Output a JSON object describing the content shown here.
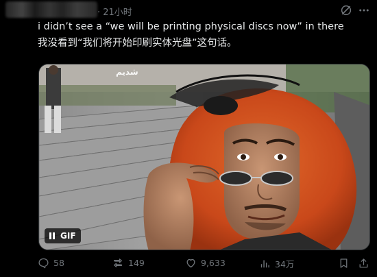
{
  "header": {
    "timestamp": "· 21小时",
    "grok_icon": "grok-icon",
    "more_icon": "more-dots-icon"
  },
  "tweet": {
    "text_line1": "i didn’t see a “we will be printing physical discs now” in there",
    "text_line2": "我没看到“我们将开始印刷实体光盘”这句话。"
  },
  "media": {
    "badge_label": "GIF",
    "pause_icon": "pause-icon",
    "watermark": "شديم"
  },
  "actions": {
    "replies": "58",
    "reposts": "149",
    "likes": "9,633",
    "views": "34万",
    "bookmark_icon": "bookmark-icon",
    "share_icon": "share-icon"
  },
  "colors": {
    "background": "#000000",
    "text": "#e7e9ea",
    "secondary": "#71767b",
    "wig": "#d2521e"
  }
}
